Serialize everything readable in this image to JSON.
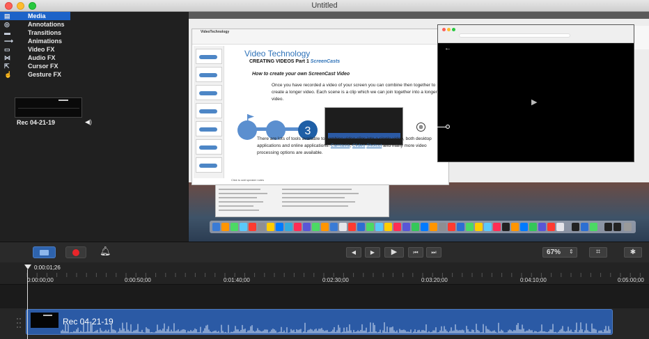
{
  "window": {
    "title": "Untitled"
  },
  "sidebar": {
    "items": [
      {
        "label": "Media",
        "icon": "media-icon",
        "glyph": "▤"
      },
      {
        "label": "Annotations",
        "icon": "annotations-icon",
        "glyph": "◎"
      },
      {
        "label": "Transitions",
        "icon": "transitions-icon",
        "glyph": "▬"
      },
      {
        "label": "Animations",
        "icon": "animations-icon",
        "glyph": "⟶"
      },
      {
        "label": "Video FX",
        "icon": "video-fx-icon",
        "glyph": "▭"
      },
      {
        "label": "Audio FX",
        "icon": "audio-fx-icon",
        "glyph": "⋈"
      },
      {
        "label": "Cursor FX",
        "icon": "cursor-fx-icon",
        "glyph": "⇱"
      },
      {
        "label": "Gesture FX",
        "icon": "gesture-fx-icon",
        "glyph": "☝"
      }
    ],
    "clip": {
      "name": "Rec 04-21-19",
      "audio_glyph": "◀)"
    }
  },
  "canvas": {
    "slides_doc_name": "VideoTechnology",
    "slide": {
      "title": "Video Technology",
      "subtitle": "CREATING VIDEOS Part 1 ",
      "subtitle_em": "ScreenCasts",
      "heading": "How to create your own ScreenCast Video",
      "para1": "Once you have recorded a video of your screen you can combine then together to create a longer video.  Each scene is a clip which we can join together into a longer video.",
      "diagram_number": "3",
      "para2_a": "There are lots of tools available to combine video clips into a single video, both desktop applications and online applications. ",
      "link1": "Camtasia",
      "para2_b": ", ",
      "link2": "Clideo",
      "para2_c": " ",
      "link3": "Shotcut",
      "para2_d": " and many more video processing options are available.",
      "notes": "Click to add speaker notes"
    },
    "video_play_glyph": "▶",
    "back_glyph": "←",
    "handle_glyph": "⊗"
  },
  "toolbar": {
    "controls": [
      {
        "name": "rewind-button",
        "glyph": "◀"
      },
      {
        "name": "step-forward-button",
        "glyph": "▶"
      },
      {
        "name": "play-button",
        "glyph": "▶"
      },
      {
        "name": "skip-back-button",
        "glyph": "⏮"
      },
      {
        "name": "skip-forward-button",
        "glyph": "⏭"
      }
    ],
    "zoom": "67%",
    "zoom_arrow": "⇕",
    "crop_glyph": "⌗",
    "settings_glyph": "✱"
  },
  "timeline": {
    "playhead_time": "0:00:01;26",
    "ticks": [
      "0:00:00;00",
      "0:00:50;00",
      "0:01:40;00",
      "0:02:30;00",
      "0:03:20;00",
      "0:04:10;00",
      "0:05:00;00"
    ],
    "clip_label": "Rec 04-21-19"
  },
  "colors": {
    "accent": "#1d63c8",
    "clip": "#2b5aa5",
    "record": "#e8252a"
  }
}
